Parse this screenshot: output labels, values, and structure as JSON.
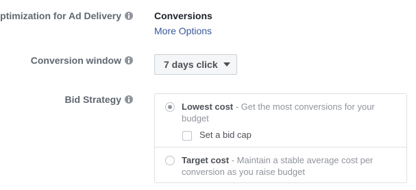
{
  "optimization": {
    "label": "Optimization for Ad Delivery",
    "value": "Conversions",
    "more_link": "More Options"
  },
  "conversion_window": {
    "label": "Conversion window",
    "selected": "7 days click"
  },
  "bid_strategy": {
    "label": "Bid Strategy",
    "options": [
      {
        "title": "Lowest cost",
        "description": " - Get the most conversions for your budget",
        "selected": true
      },
      {
        "title": "Target cost",
        "description": " - Maintain a stable average cost per conversion as you raise budget",
        "selected": false
      }
    ],
    "bid_cap_label": "Set a bid cap",
    "bid_cap_checked": false
  },
  "icons": {
    "info": "info-icon",
    "dropdown": "caret-down-icon"
  },
  "colors": {
    "label": "#606770",
    "link": "#365899",
    "text": "#1d2129",
    "muted": "#90949c",
    "border": "#dddfe2"
  }
}
